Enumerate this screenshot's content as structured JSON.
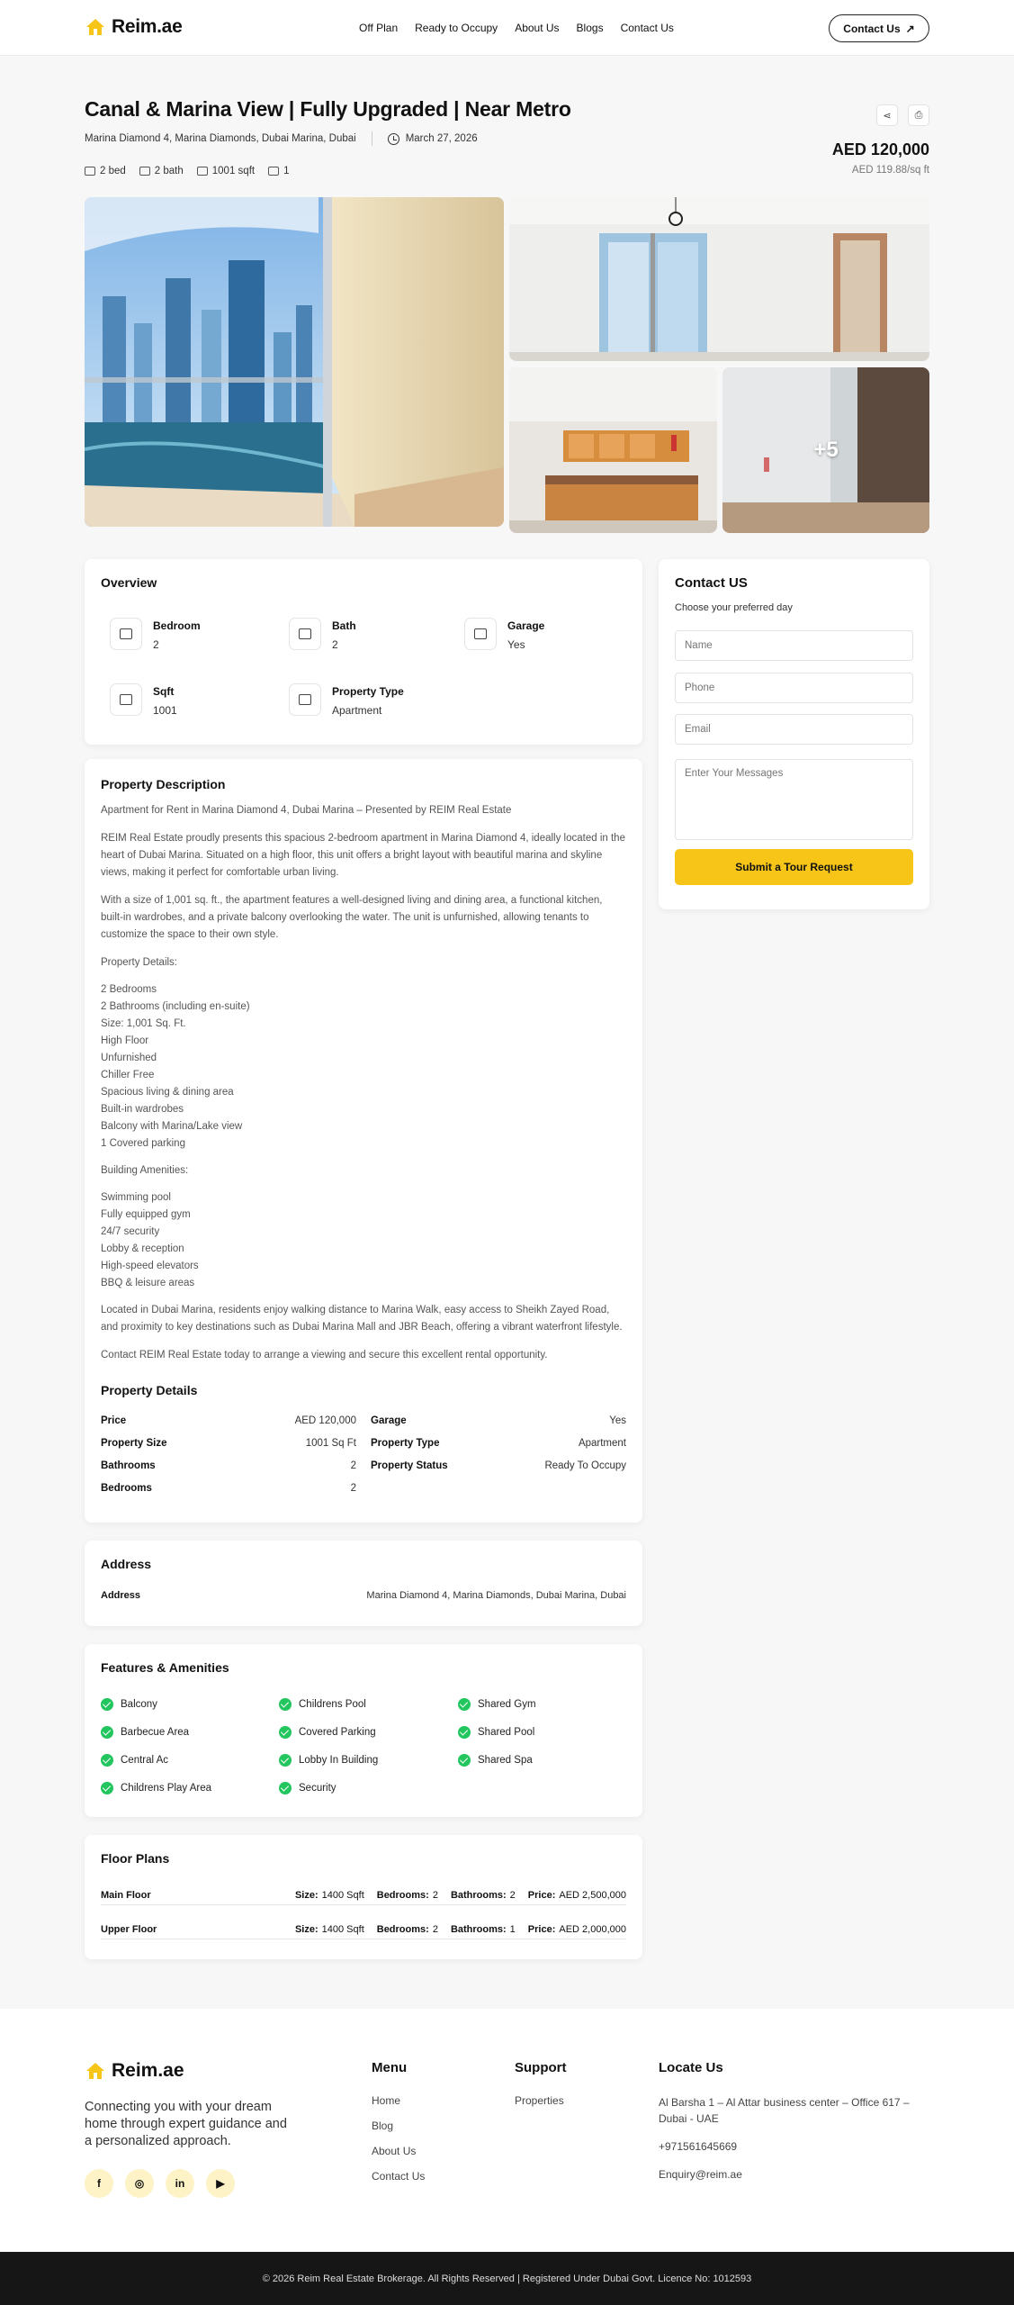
{
  "header": {
    "brand": "Reim.ae",
    "nav": [
      "Off Plan",
      "Ready to Occupy",
      "About Us",
      "Blogs",
      "Contact Us"
    ],
    "contact_button": "Contact Us"
  },
  "listing": {
    "title": "Canal & Marina View | Fully Upgraded | Near Metro",
    "address": "Marina Diamond 4, Marina Diamonds, Dubai Marina, Dubai",
    "date": "March 27, 2026",
    "specs": {
      "bed": "2 bed",
      "bath": "2 bath",
      "sqft": "1001 sqft",
      "garage": "1"
    },
    "price": "AED 120,000",
    "price_per_sqft": "AED 119.88/sq ft",
    "gallery_more": "+5"
  },
  "overview": {
    "heading": "Overview",
    "items": [
      {
        "label": "Bedroom",
        "value": "2"
      },
      {
        "label": "Bath",
        "value": "2"
      },
      {
        "label": "Garage",
        "value": "Yes"
      },
      {
        "label": "Sqft",
        "value": "1001"
      },
      {
        "label": "Property Type",
        "value": "Apartment"
      }
    ]
  },
  "description": {
    "heading": "Property Description",
    "intro": "Apartment for Rent in Marina Diamond 4, Dubai Marina – Presented by REIM Real Estate",
    "p1": "REIM Real Estate proudly presents this spacious 2-bedroom apartment in Marina Diamond 4, ideally located in the heart of Dubai Marina. Situated on a high floor, this unit offers a bright layout with beautiful marina and skyline views, making it perfect for comfortable urban living.",
    "p2": "With a size of 1,001 sq. ft., the apartment features a well-designed living and dining area, a functional kitchen, built-in wardrobes, and a private balcony overlooking the water. The unit is unfurnished, allowing tenants to customize the space to their own style.",
    "details_label": "Property Details:",
    "details": [
      "2 Bedrooms",
      "2 Bathrooms (including en-suite)",
      "Size: 1,001 Sq. Ft.",
      "High Floor",
      "Unfurnished",
      "Chiller Free",
      "Spacious living & dining area",
      "Built-in wardrobes",
      "Balcony with Marina/Lake view",
      "1 Covered parking"
    ],
    "amenities_label": "Building Amenities:",
    "amenities": [
      "Swimming pool",
      "Fully equipped gym",
      "24/7 security",
      "Lobby & reception",
      "High-speed elevators",
      "BBQ & leisure areas"
    ],
    "p3": "Located in Dubai Marina, residents enjoy walking distance to Marina Walk, easy access to Sheikh Zayed Road, and proximity to key destinations such as Dubai Marina Mall and JBR Beach, offering a vibrant waterfront lifestyle.",
    "p4": "Contact REIM Real Estate today to arrange a viewing and secure this excellent rental opportunity."
  },
  "property_details": {
    "heading": "Property Details",
    "left": [
      {
        "label": "Price",
        "value": "AED 120,000"
      },
      {
        "label": "Property Size",
        "value": "1001 Sq Ft"
      },
      {
        "label": "Bathrooms",
        "value": "2"
      },
      {
        "label": "Bedrooms",
        "value": "2"
      }
    ],
    "right": [
      {
        "label": "Garage",
        "value": "Yes"
      },
      {
        "label": "Property Type",
        "value": "Apartment"
      },
      {
        "label": "Property Status",
        "value": "Ready To Occupy"
      }
    ]
  },
  "address_card": {
    "heading": "Address",
    "label": "Address",
    "value": "Marina Diamond 4, Marina Diamonds, Dubai Marina, Dubai"
  },
  "features": {
    "heading": "Features & Amenities",
    "items": [
      "Balcony",
      "Childrens Pool",
      "Shared Gym",
      "Barbecue Area",
      "Covered Parking",
      "Shared Pool",
      "Central Ac",
      "Lobby In Building",
      "Shared Spa",
      "Childrens Play Area",
      "Security"
    ]
  },
  "floor_plans": {
    "heading": "Floor Plans",
    "size_label": "Size:",
    "bedrooms_label": "Bedrooms:",
    "bathrooms_label": "Bathrooms:",
    "price_label": "Price:",
    "rows": [
      {
        "name": "Main Floor",
        "size": "1400 Sqft",
        "bedrooms": "2",
        "bathrooms": "2",
        "price": "AED 2,500,000"
      },
      {
        "name": "Upper Floor",
        "size": "1400 Sqft",
        "bedrooms": "2",
        "bathrooms": "1",
        "price": "AED 2,000,000"
      }
    ]
  },
  "contact_form": {
    "heading": "Contact US",
    "subheading": "Choose your preferred day",
    "name_placeholder": "Name",
    "phone_placeholder": "Phone",
    "email_placeholder": "Email",
    "message_placeholder": "Enter Your Messages",
    "submit": "Submit a Tour Request"
  },
  "footer": {
    "brand": "Reim.ae",
    "tagline": "Connecting you with your dream home through expert guidance and a personalized approach.",
    "social": [
      "facebook-icon",
      "instagram-icon",
      "linkedin-icon",
      "youtube-icon"
    ],
    "menu_heading": "Menu",
    "menu": [
      "Home",
      "Blog",
      "About Us",
      "Contact Us"
    ],
    "support_heading": "Support",
    "support": [
      "Properties"
    ],
    "locate_heading": "Locate Us",
    "address": "Al Barsha 1 – Al Attar business center – Office 617 – Dubai - UAE",
    "phone": "+971561645669",
    "email": "Enquiry@reim.ae",
    "copyright": "© 2026 Reim Real Estate Brokerage. All Rights Reserved | Registered Under Dubai Govt. Licence No: 1012593"
  },
  "colors": {
    "accent": "#f6c518",
    "check": "#22c55e",
    "footer_bar": "#161616"
  }
}
